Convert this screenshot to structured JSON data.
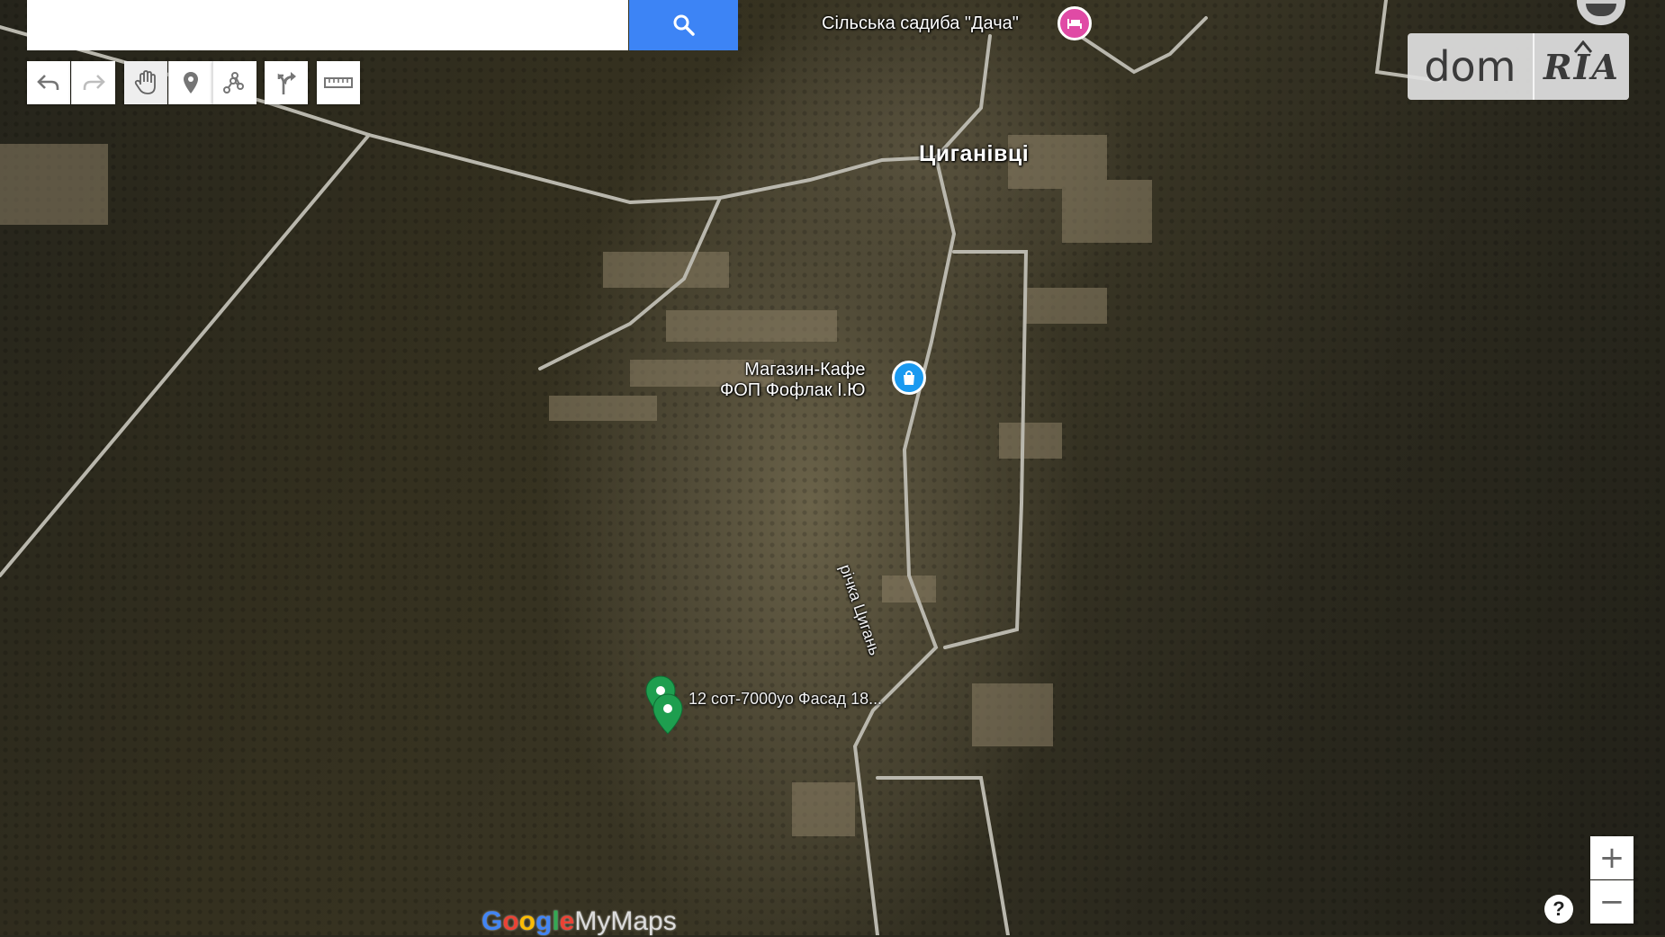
{
  "search": {
    "value": "",
    "placeholder": ""
  },
  "toolbar": [
    {
      "icon": "undo-icon"
    },
    {
      "icon": "redo-icon"
    },
    {
      "icon": "pan-hand-icon"
    },
    {
      "icon": "add-marker-icon"
    },
    {
      "icon": "draw-line-icon"
    },
    {
      "icon": "directions-icon"
    },
    {
      "icon": "ruler-icon"
    }
  ],
  "map": {
    "village": "Циганівці",
    "poi_dacha": "Сільська садиба \"Дача\"",
    "poi_shop_line1": "Магазин-Кафе",
    "poi_shop_line2": "ФОП Фофлак І.Ю",
    "river": "річка Цигань",
    "listing_pin": "12 сот-7000уо Фасад 18...",
    "colors": {
      "hotel_pin": "#e04aa5",
      "shop_pin": "#1a9af0",
      "listing_pin": "#1e9e4f"
    }
  },
  "logo": {
    "dom": "dom",
    "ria": "RIA"
  },
  "zoom": {
    "in": "+",
    "out": "−"
  },
  "help": "?",
  "brand": {
    "g1": "G",
    "g2": "o",
    "g3": "o",
    "g4": "g",
    "g5": "l",
    "g6": "e",
    "mymaps": "MyMaps"
  }
}
